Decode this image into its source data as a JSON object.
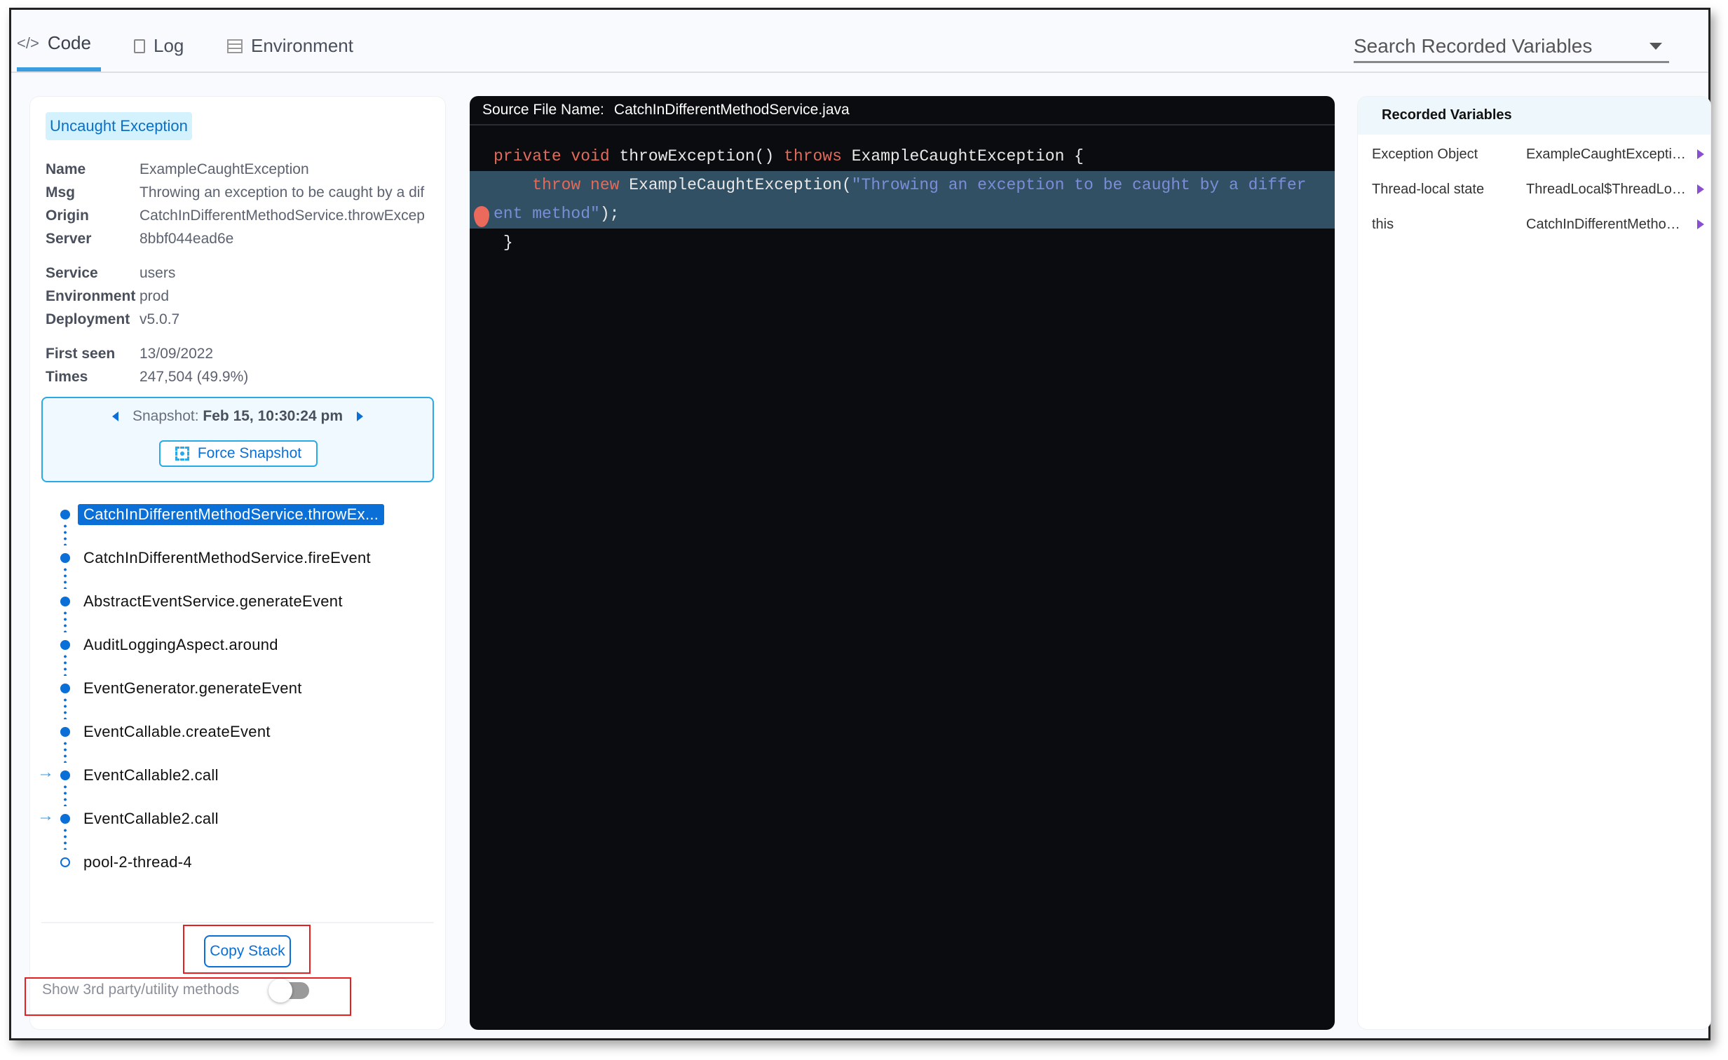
{
  "tabs": [
    {
      "label": "Code",
      "icon": "code-icon"
    },
    {
      "label": "Log",
      "icon": "document-icon"
    },
    {
      "label": "Environment",
      "icon": "table-icon"
    }
  ],
  "search": {
    "placeholder": "Search Recorded Variables"
  },
  "exception": {
    "badge": "Uncaught Exception",
    "fields": [
      {
        "k": "Name",
        "v": "ExampleCaughtException"
      },
      {
        "k": "Msg",
        "v": "Throwing an exception to be caught by a dif"
      },
      {
        "k": "Origin",
        "v": "CatchInDifferentMethodService.throwExcep"
      },
      {
        "k": "Server",
        "v": "8bbf044ead6e"
      },
      {
        "k": "Service",
        "v": "users"
      },
      {
        "k": "Environment",
        "v": "prod"
      },
      {
        "k": "Deployment",
        "v": "v5.0.7"
      },
      {
        "k": "First seen",
        "v": "13/09/2022"
      },
      {
        "k": "Times",
        "v": "247,504 (49.9%)"
      }
    ]
  },
  "snapshot": {
    "label": "Snapshot:",
    "value": "Feb 15, 10:30:24 pm",
    "force_label": "Force Snapshot"
  },
  "stack": [
    "CatchInDifferentMethodService.throwEx...",
    "CatchInDifferentMethodService.fireEvent",
    "AbstractEventService.generateEvent",
    "AuditLoggingAspect.around",
    "EventGenerator.generateEvent",
    "EventCallable.createEvent",
    "EventCallable2.call",
    "EventCallable2.call",
    "pool-2-thread-4"
  ],
  "copy_stack_label": "Copy Stack",
  "toggle": {
    "label": "Show 3rd party/utility methods",
    "on": false
  },
  "code": {
    "file_label": "Source File Name:",
    "file_name": "CatchInDifferentMethodService.java",
    "l1": {
      "kw1": "private void",
      "t1": " throwException() ",
      "kw2": "throws",
      "t2": " ExampleCaughtException {"
    },
    "l2": {
      "kw": "throw new",
      "t": " ExampleCaughtException(",
      "s": "\"Throwing an exception to be caught by a differ"
    },
    "l3": {
      "s": "ent method\"",
      "t": ");"
    },
    "l4": "}"
  },
  "variables": {
    "title": "Recorded Variables",
    "rows": [
      {
        "name": "Exception Object",
        "value": "ExampleCaughtException"
      },
      {
        "name": "Thread-local state",
        "value": "ThreadLocal$ThreadLocalMap"
      },
      {
        "name": "this",
        "value": "CatchInDifferentMethodService"
      }
    ]
  },
  "colors": {
    "accent": "#0a6fd6",
    "highlight": "#325064",
    "keyword": "#e26a5a",
    "string": "#7a8ed8"
  }
}
